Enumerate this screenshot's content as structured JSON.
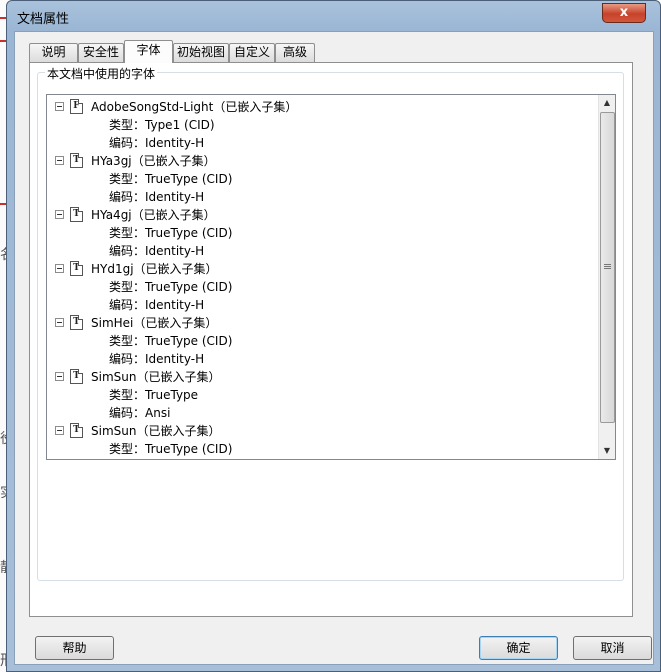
{
  "dialog": {
    "title": "文档属性",
    "close_label": "x"
  },
  "tabs": [
    {
      "label": "说明"
    },
    {
      "label": "安全性"
    },
    {
      "label": "字体",
      "active": true
    },
    {
      "label": "初始视图"
    },
    {
      "label": "自定义"
    },
    {
      "label": "高级"
    }
  ],
  "fonts_group": {
    "title": "本文档中使用的字体",
    "fonts": [
      {
        "name": "AdobeSongStd-Light（已嵌入子集）",
        "icon": "F",
        "type": "类型：Type1 (CID)",
        "encoding": "编码：Identity-H"
      },
      {
        "name": "HYa3gj（已嵌入子集）",
        "icon": "T",
        "type": "类型：TrueType (CID)",
        "encoding": "编码：Identity-H"
      },
      {
        "name": "HYa4gj（已嵌入子集）",
        "icon": "T",
        "type": "类型：TrueType (CID)",
        "encoding": "编码：Identity-H"
      },
      {
        "name": "HYd1gj（已嵌入子集）",
        "icon": "T",
        "type": "类型：TrueType (CID)",
        "encoding": "编码：Identity-H"
      },
      {
        "name": "SimHei（已嵌入子集）",
        "icon": "T",
        "type": "类型：TrueType (CID)",
        "encoding": "编码：Identity-H"
      },
      {
        "name": "SimSun（已嵌入子集）",
        "icon": "T",
        "type": "类型：TrueType",
        "encoding": "编码：Ansi"
      },
      {
        "name": "SimSun（已嵌入子集）",
        "icon": "T",
        "type": "类型：TrueType (CID)",
        "encoding": null
      }
    ]
  },
  "buttons": {
    "help": "帮助",
    "ok": "确定",
    "cancel": "取消"
  },
  "background_doc": {
    "glyphs": [
      "名",
      "役",
      "实",
      "靜",
      "邢"
    ]
  }
}
